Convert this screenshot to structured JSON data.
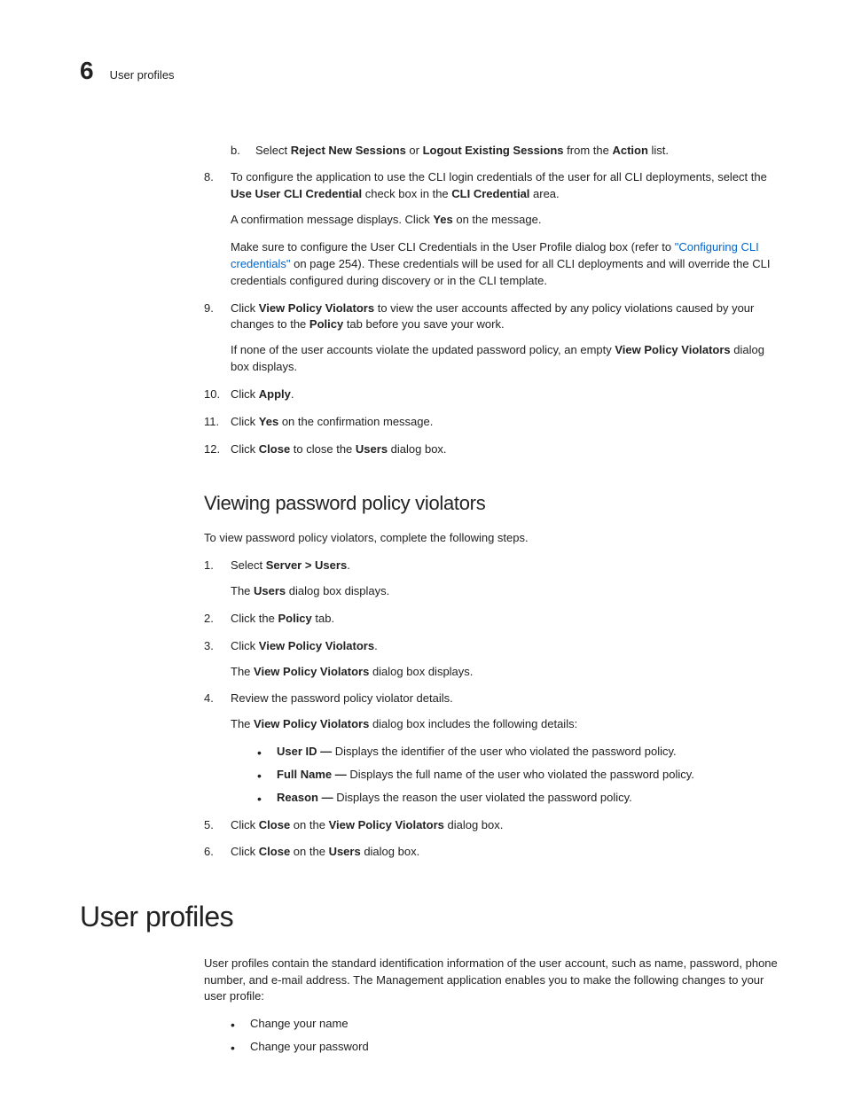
{
  "header": {
    "chapter_number": "6",
    "chapter_title": "User profiles"
  },
  "step_b": {
    "letter": "b.",
    "pre": "Select ",
    "b1": "Reject New Sessions",
    "mid1": " or ",
    "b2": "Logout Existing Sessions",
    "mid2": " from the ",
    "b3": "Action",
    "post": " list."
  },
  "step8": {
    "num": "8.",
    "line1_pre": "To configure the application to use the CLI login credentials of the user for all CLI deployments, select the ",
    "line1_b1": "Use User CLI Credential",
    "line1_mid": " check box in the ",
    "line1_b2": "CLI Credential",
    "line1_post": " area.",
    "para2_pre": "A confirmation message displays. Click ",
    "para2_b": "Yes",
    "para2_post": " on the message.",
    "para3_pre": "Make sure to configure the User CLI Credentials in the User Profile dialog box (refer to ",
    "para3_link": "\"Configuring CLI credentials\"",
    "para3_post": " on page 254). These credentials will be used for all CLI deployments and will override the CLI credentials configured during discovery or in the CLI template."
  },
  "step9": {
    "num": "9.",
    "line1_pre": "Click ",
    "line1_b1": "View Policy Violators",
    "line1_mid": " to view the user accounts affected by any policy violations caused by your changes to the ",
    "line1_b2": "Policy",
    "line1_post": " tab before you save your work.",
    "para2_pre": "If none of the user accounts violate the updated password policy, an empty ",
    "para2_b": "View Policy Violators",
    "para2_post": " dialog box displays."
  },
  "step10": {
    "num": "10.",
    "pre": "Click ",
    "b": "Apply",
    "post": "."
  },
  "step11": {
    "num": "11.",
    "pre": "Click ",
    "b": "Yes",
    "post": " on the confirmation message."
  },
  "step12": {
    "num": "12.",
    "pre": "Click ",
    "b": "Close",
    "mid": " to close the ",
    "b2": "Users",
    "post": " dialog box."
  },
  "section2": {
    "title": "Viewing password policy violators",
    "intro": "To view password policy violators, complete the following steps.",
    "s1": {
      "num": "1.",
      "pre": "Select ",
      "b": "Server > Users",
      "post": ".",
      "p2_pre": "The ",
      "p2_b": "Users",
      "p2_post": " dialog box displays."
    },
    "s2": {
      "num": "2.",
      "pre": "Click the ",
      "b": "Policy",
      "post": " tab."
    },
    "s3": {
      "num": "3.",
      "pre": "Click ",
      "b": "View Policy Violators",
      "post": ".",
      "p2_pre": "The ",
      "p2_b": "View Policy Violators",
      "p2_post": " dialog box displays."
    },
    "s4": {
      "num": "4.",
      "line": "Review the password policy violator details.",
      "p2_pre": "The ",
      "p2_b": "View Policy Violators",
      "p2_post": " dialog box includes the following details:",
      "bullets": [
        {
          "b": "User ID — ",
          "t": "Displays the identifier of the user who violated the password policy."
        },
        {
          "b": "Full Name — ",
          "t": "Displays the full name of the user who violated the password policy."
        },
        {
          "b": "Reason — ",
          "t": "Displays the reason the user violated the password policy."
        }
      ]
    },
    "s5": {
      "num": "5.",
      "pre": "Click ",
      "b": "Close",
      "mid": " on the ",
      "b2": "View Policy Violators",
      "post": " dialog box."
    },
    "s6": {
      "num": "6.",
      "pre": "Click ",
      "b": "Close",
      "mid": " on the ",
      "b2": "Users",
      "post": " dialog box."
    }
  },
  "main_section": {
    "title": "User profiles",
    "intro": "User profiles contain the standard identification information of the user account, such as name, password, phone number, and e-mail address. The Management application enables you to make the following changes to your user profile:",
    "bullets": [
      "Change your name",
      "Change your password"
    ]
  }
}
